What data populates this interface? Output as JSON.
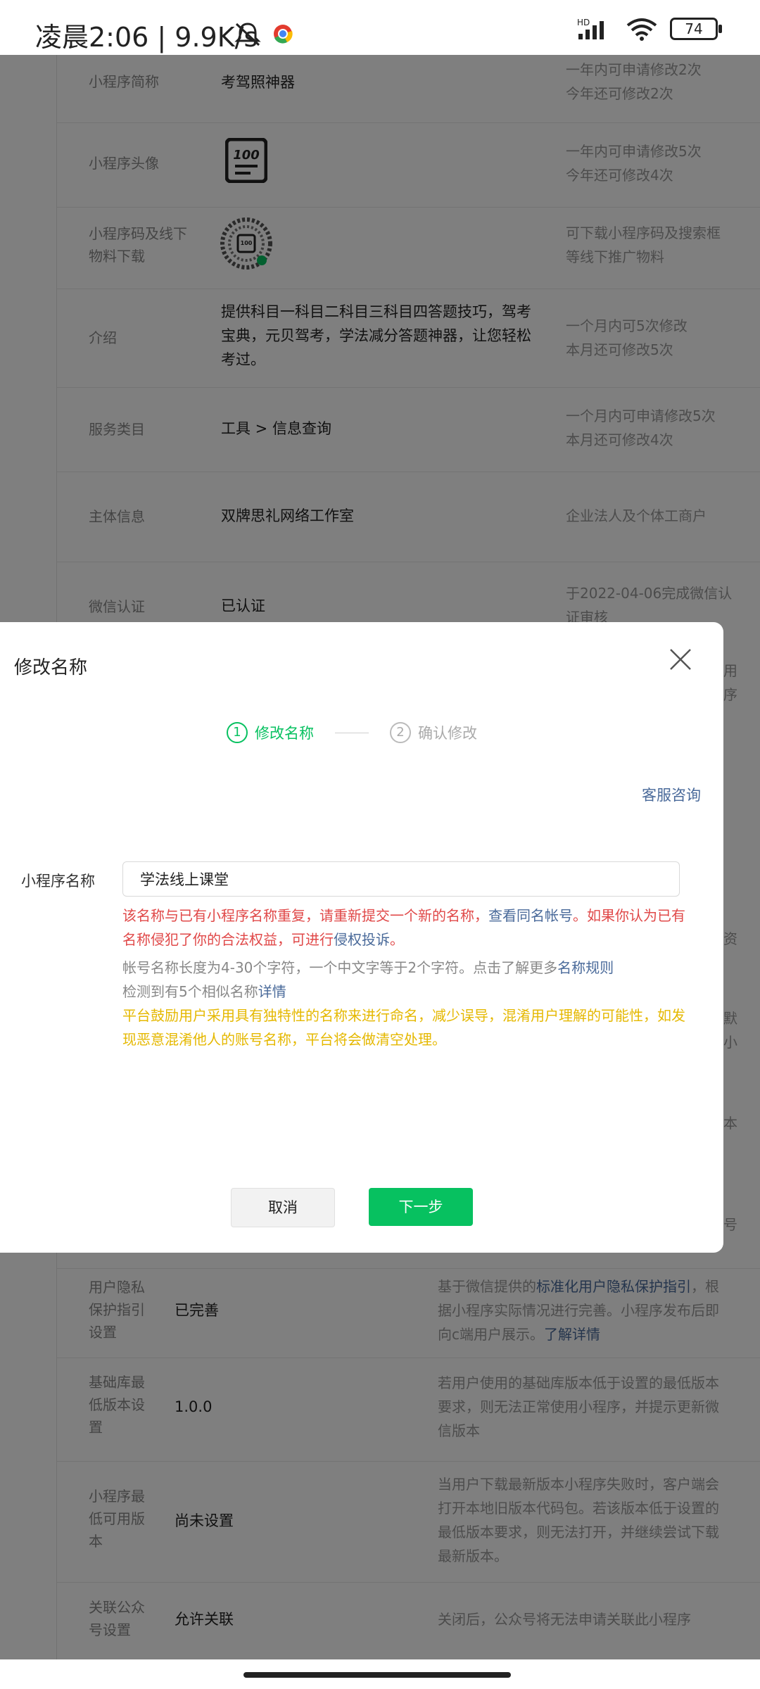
{
  "status_bar": {
    "time": "凌晨2:06 | 9.9K/s",
    "network": "HD",
    "battery": "74"
  },
  "background": {
    "rows": [
      {
        "key": "小程序简称",
        "value": "考驾照神器",
        "desc": "一年内可申请修改2次\n今年还可修改2次"
      },
      {
        "key": "小程序头像",
        "value": "",
        "desc": "一年内可申请修改5次\n今年还可修改4次"
      },
      {
        "key": "小程序码及线下\n物料下载",
        "value": "",
        "desc": "可下载小程序码及搜索框\n等线下推广物料"
      },
      {
        "key": "介绍",
        "value": "提供科目一科目二科目三科目四答题技巧，驾考\n宝典，元贝驾考，学法减分答题神器，让您轻松\n考过。",
        "desc": "一个月内可5次修改\n本月还可修改5次"
      },
      {
        "key": "服务类目",
        "value": "工具 > 信息查询",
        "desc": "一个月内可申请修改5次\n本月还可修改4次"
      },
      {
        "key": "主体信息",
        "value": "双牌思礼网络工作室",
        "desc": "企业法人及个体工商户"
      },
      {
        "key": "微信认证",
        "value": "已认证",
        "desc": "于2022-04-06完成微信认\n证审核"
      }
    ],
    "lower_rows": [
      {
        "key": "用户隐私\n保护指引\n设置",
        "value": "已完善",
        "desc_pre": "基于微信提供的",
        "desc_link": "标准化用户隐私保护指引",
        "desc_post": "，根\n据小程序实际情况进行完善。小程序发布后即\n向c端用户展示。",
        "desc_link2": "了解详情"
      },
      {
        "key": "基础库最\n低版本设\n置",
        "value": "1.0.0",
        "desc": "若用户使用的基础库版本低于设置的最低版本\n要求，则无法正常使用小程序，并提示更新微\n信版本"
      },
      {
        "key": "小程序最\n低可用版\n本",
        "value": "尚未设置",
        "desc": "当用户下载最新版本小程序失败时，客户端会\n打开本地旧版本代码包。若该版本低于设置的\n最低版本要求，则无法打开，并继续尝试下载\n最新版本。"
      },
      {
        "key": "关联公众\n号设置",
        "value": "允许关联",
        "desc": "关闭后，公众号将无法申请关联此小程序"
      }
    ],
    "peek": [
      "用",
      "序",
      "资",
      "默",
      "小",
      "本",
      "号"
    ]
  },
  "modal": {
    "title": "修改名称",
    "steps": [
      {
        "num": "1",
        "label": "修改名称",
        "active": true
      },
      {
        "num": "2",
        "label": "确认修改",
        "active": false
      }
    ],
    "service_link": "客服咨询",
    "field_label": "小程序名称",
    "input_value": "学法线上课堂",
    "error_pre": "该名称与已有小程序名称重复，请重新提交一个新的名称，",
    "error_link1": "查看同名帐号",
    "error_mid": "。如果你认为已有名称侵犯了你的合法权益，可进行",
    "error_link2": "侵权投诉",
    "error_post": "。",
    "tip1_pre": "帐号名称长度为4-30个字符，一个中文字等于2个字符。点击了解更多",
    "tip1_link": "名称规则",
    "tip2_pre": "检测到有5个相似名称",
    "tip2_link": "详情",
    "warning": "平台鼓励用户采用具有独特性的名称来进行命名，减少误导，混淆用户理解的可能性，如发现恶意混淆他人的账号名称，平台将会做清空处理。",
    "cancel_label": "取消",
    "next_label": "下一步"
  },
  "colors": {
    "accent": "#07c160",
    "error": "#e04848",
    "warning": "#e5b800",
    "link": "#4a6a9a"
  }
}
